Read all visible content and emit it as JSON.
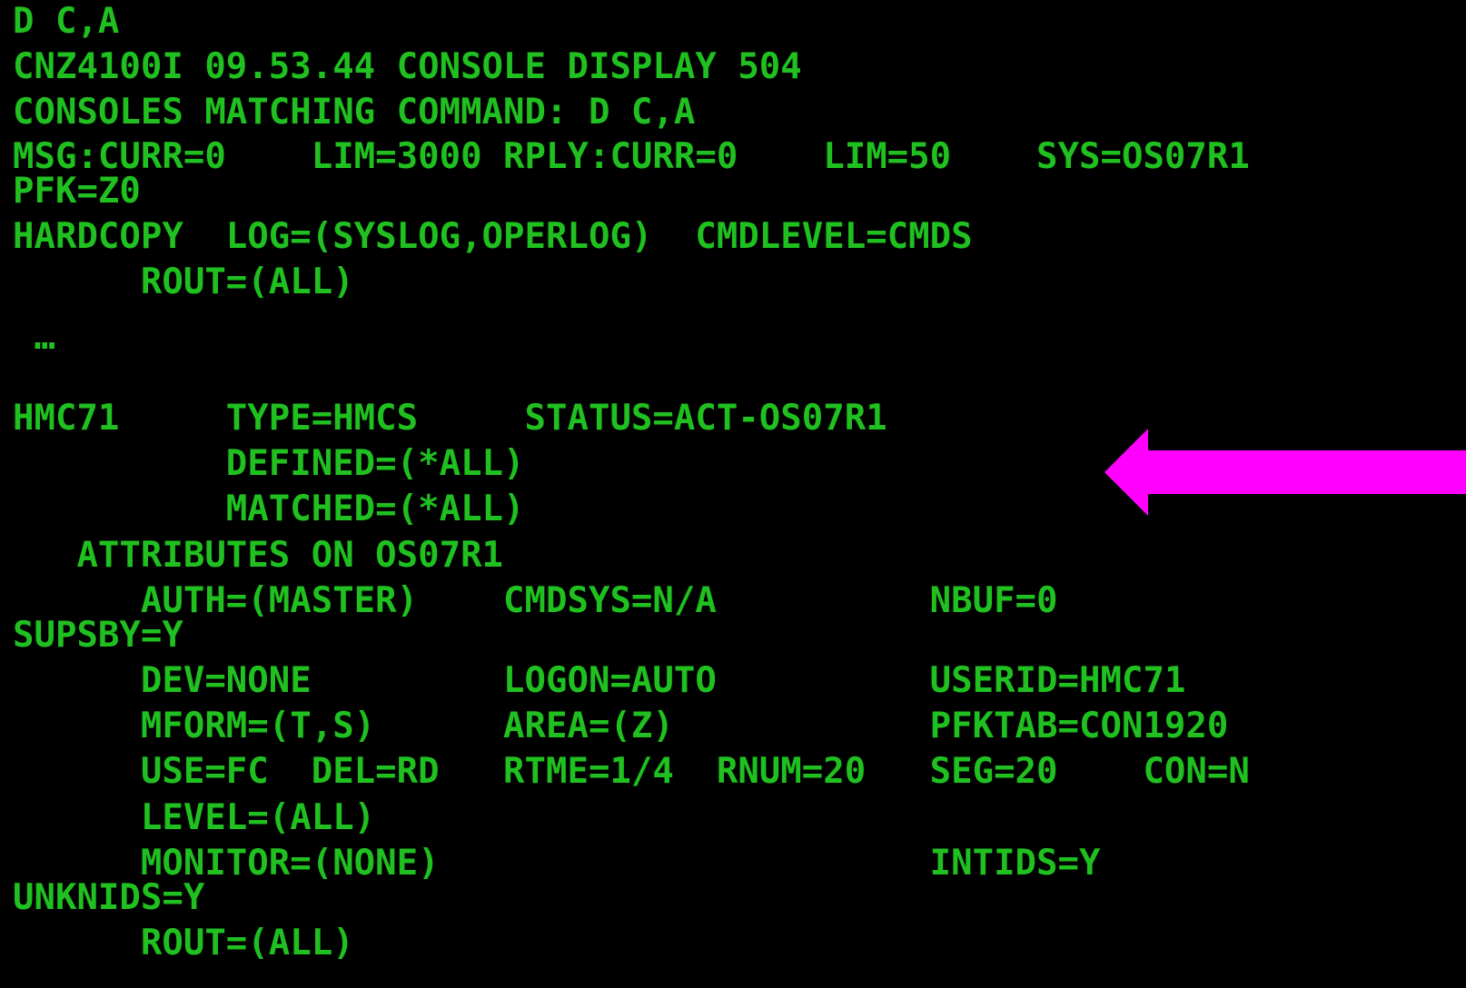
{
  "console": {
    "text_color": "#1fc01f",
    "background": "#000000",
    "lines": [
      "D C,A",
      "CNZ4100I 09.53.44 CONSOLE DISPLAY 504",
      "CONSOLES MATCHING COMMAND: D C,A",
      "MSG:CURR=0    LIM=3000 RPLY:CURR=0    LIM=50    SYS=OS07R1",
      "PFK=Z0",
      "HARDCOPY  LOG=(SYSLOG,OPERLOG)  CMDLEVEL=CMDS",
      "      ROUT=(ALL)",
      " …",
      "HMC71     TYPE=HMCS     STATUS=ACT-OS07R1",
      "          DEFINED=(*ALL)",
      "          MATCHED=(*ALL)",
      "   ATTRIBUTES ON OS07R1",
      "      AUTH=(MASTER)    CMDSYS=N/A          NBUF=0",
      "SUPSBY=Y",
      "      DEV=NONE         LOGON=AUTO          USERID=HMC71",
      "      MFORM=(T,S)      AREA=(Z)            PFKTAB=CON1920",
      "      USE=FC  DEL=RD   RTME=1/4  RNUM=20   SEG=20    CON=N",
      "      LEVEL=(ALL)",
      "      MONITOR=(NONE)                       INTIDS=Y",
      "UNKNIDS=Y",
      "      ROUT=(ALL)"
    ]
  },
  "annotation": {
    "arrow_icon": "left-arrow-icon",
    "arrow_color": "#ff00ff"
  }
}
